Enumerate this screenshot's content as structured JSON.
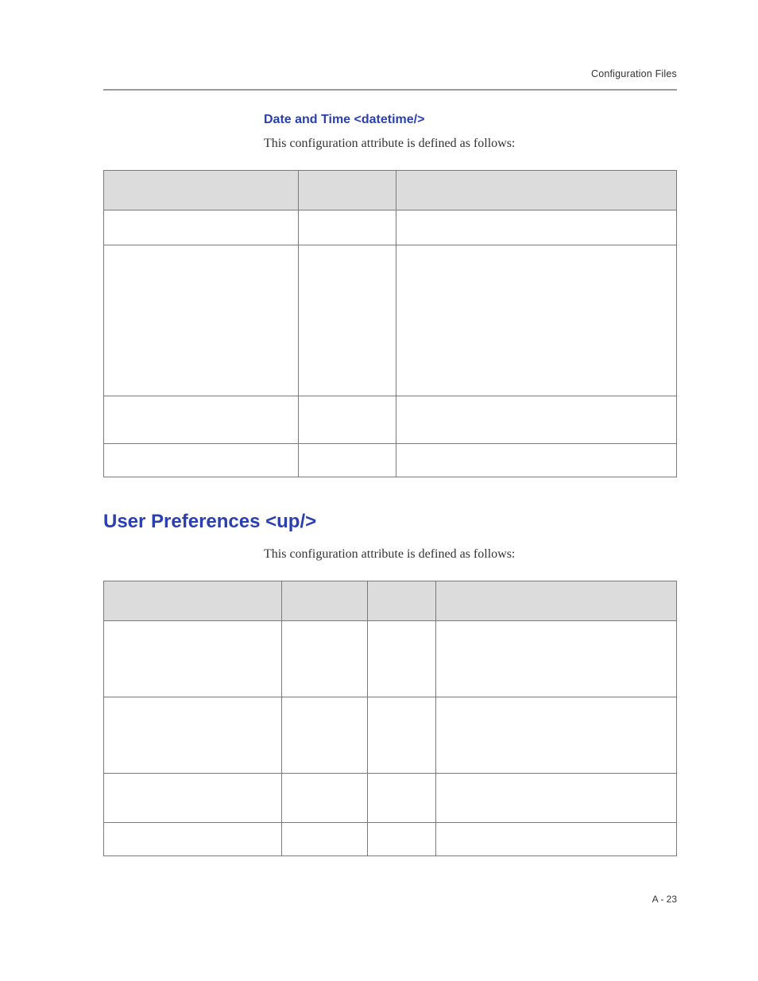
{
  "running_head": "Configuration Files",
  "section_sub_title": "Date and Time <datetime/>",
  "lede_text": "This configuration attribute is defined as follows:",
  "section_title": "User Preferences <up/>",
  "lede_text_2": "This configuration attribute is defined as follows:",
  "folio": "A - 23"
}
